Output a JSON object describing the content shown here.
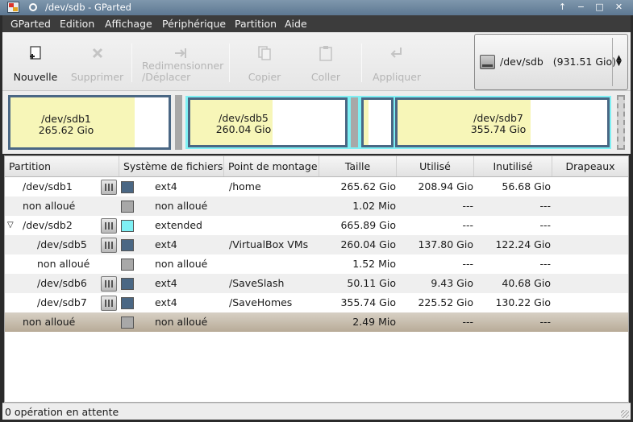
{
  "window": {
    "title": "/dev/sdb - GParted",
    "buttons": [
      "↑",
      "−",
      "□",
      "✕"
    ]
  },
  "menu": [
    "GParted",
    "Edition",
    "Affichage",
    "Périphérique",
    "Partition",
    "Aide"
  ],
  "toolbar": {
    "new": "Nouvelle",
    "delete": "Supprimer",
    "resize_1": "Redimensionner",
    "resize_2": "/Déplacer",
    "copy": "Copier",
    "paste": "Coller",
    "apply": "Appliquer",
    "device": "/dev/sdb   (931.51 Gio)"
  },
  "map": {
    "sdb1": {
      "name": "/dev/sdb1",
      "size": "265.62 Gio",
      "used_frac": 0.787
    },
    "sdb5": {
      "name": "/dev/sdb5",
      "size": "260.04 Gio",
      "used_frac": 0.53
    },
    "sdb6": {
      "used_frac": 0.19
    },
    "sdb7": {
      "name": "/dev/sdb7",
      "size": "355.74 Gio",
      "used_frac": 0.634
    }
  },
  "table": {
    "headers": [
      "Partition",
      "Système de fichiers",
      "Point de montage",
      "Taille",
      "Utilisé",
      "Inutilisé",
      "Drapeaux"
    ],
    "rows": [
      {
        "partition": "/dev/sdb1",
        "fs": "ext4",
        "mount": "/home",
        "size": "265.62 Gio",
        "used": "208.94 Gio",
        "unused": "56.68 Gio",
        "color": "#4a6784",
        "locked": true,
        "indent": 0
      },
      {
        "partition": "non alloué",
        "fs": "non alloué",
        "mount": "",
        "size": "1.02 Mio",
        "used": "---",
        "unused": "---",
        "color": "#a8a8a8",
        "locked": false,
        "indent": 0
      },
      {
        "partition": "/dev/sdb2",
        "fs": "extended",
        "mount": "",
        "size": "665.89 Gio",
        "used": "---",
        "unused": "---",
        "color": "#7ef0f4",
        "locked": true,
        "indent": 0,
        "expander": "▽"
      },
      {
        "partition": "/dev/sdb5",
        "fs": "ext4",
        "mount": "/VirtualBox VMs",
        "size": "260.04 Gio",
        "used": "137.80 Gio",
        "unused": "122.24 Gio",
        "color": "#4a6784",
        "locked": true,
        "indent": 1
      },
      {
        "partition": "non alloué",
        "fs": "non alloué",
        "mount": "",
        "size": "1.52 Mio",
        "used": "---",
        "unused": "---",
        "color": "#a8a8a8",
        "locked": false,
        "indent": 1
      },
      {
        "partition": "/dev/sdb6",
        "fs": "ext4",
        "mount": "/SaveSlash",
        "size": "50.11 Gio",
        "used": "9.43 Gio",
        "unused": "40.68 Gio",
        "color": "#4a6784",
        "locked": true,
        "indent": 1
      },
      {
        "partition": "/dev/sdb7",
        "fs": "ext4",
        "mount": "/SaveHomes",
        "size": "355.74 Gio",
        "used": "225.52 Gio",
        "unused": "130.22 Gio",
        "color": "#4a6784",
        "locked": true,
        "indent": 1
      },
      {
        "partition": "non alloué",
        "fs": "non alloué",
        "mount": "",
        "size": "2.49 Mio",
        "used": "---",
        "unused": "---",
        "color": "#a8a8a8",
        "locked": false,
        "indent": 0,
        "selected": true
      }
    ]
  },
  "status": "0 opération en attente"
}
